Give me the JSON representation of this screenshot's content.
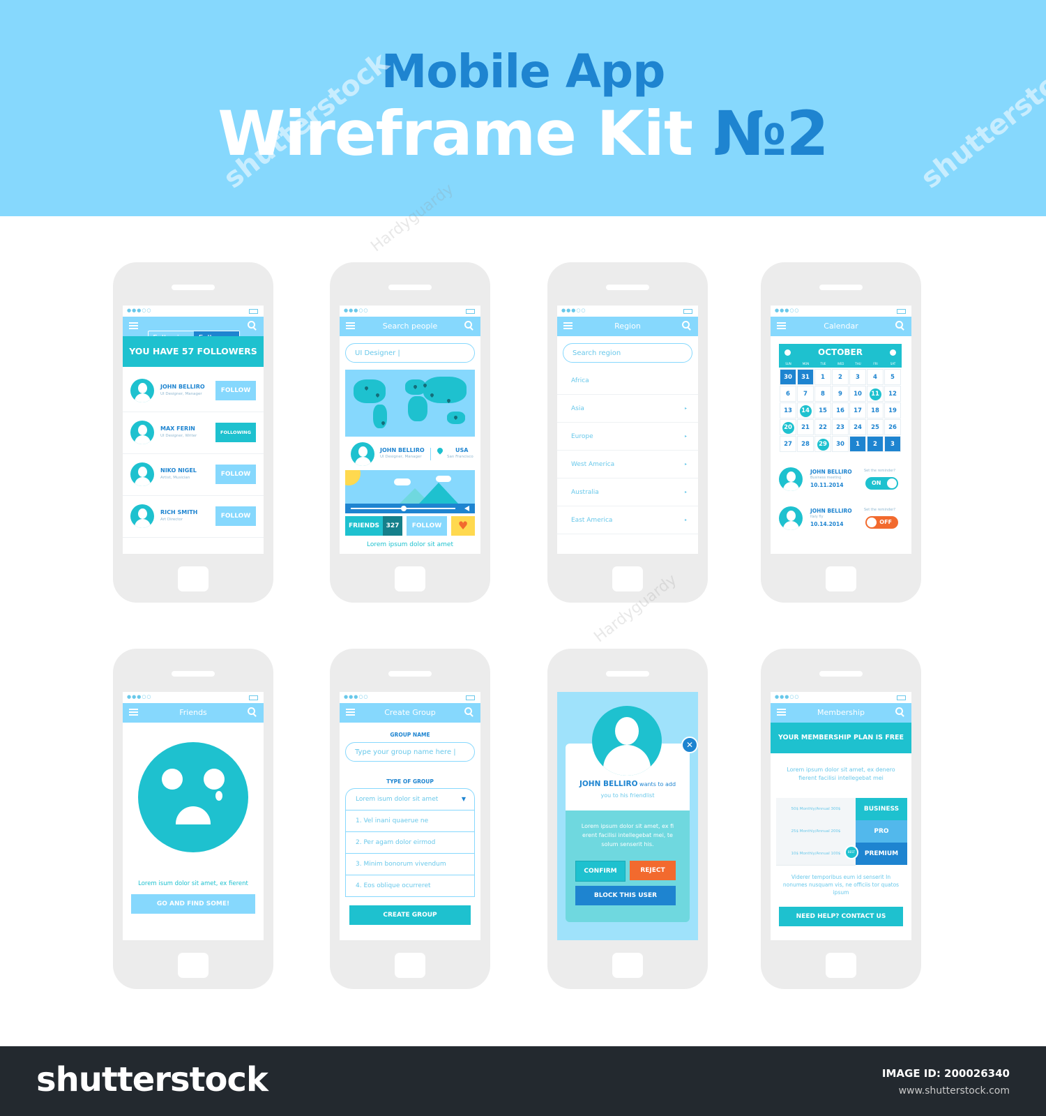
{
  "hero": {
    "line1": "Mobile App",
    "line2": "Wireframe Kit ",
    "line2_no": "№2"
  },
  "footer": {
    "logo": "shutterstock",
    "image_id": "IMAGE ID: 200026340",
    "site": "www.shutterstock.com"
  },
  "watermarks": {
    "brand": "shutterstock",
    "author": "Hardyguardy"
  },
  "colors": {
    "light_blue": "#86d8fd",
    "teal": "#1ec1cf",
    "blue": "#1e84d0",
    "orange": "#f26a2e",
    "yellow": "#ffd94f",
    "phone_body": "#ececec",
    "footer_bg": "#23292f"
  },
  "icons": {
    "menu": "hamburger-menu-icon",
    "search": "search-icon",
    "avatar": "user-avatar-icon",
    "pin": "location-pin-icon",
    "heart": "heart-icon",
    "close": "close-icon",
    "sad": "sad-face-icon"
  },
  "status_dots": "●●●○○",
  "followers": {
    "tab_following": "Following",
    "tab_followers": "Followers",
    "banner": "YOU HAVE 57 FOLLOWERS",
    "rows": [
      {
        "name": "JOHN BELLIRO",
        "role": "UI Designer, Manager",
        "action": "FOLLOW"
      },
      {
        "name": "MAX FERIN",
        "role": "UI Designer, Writer",
        "action": "FOLLOWING"
      },
      {
        "name": "NIKO NIGEL",
        "role": "Artist, Musician",
        "action": "FOLLOW"
      },
      {
        "name": "RICH SMITH",
        "role": "Art Director",
        "action": "FOLLOW"
      }
    ]
  },
  "search_people": {
    "title": "Search people",
    "query": "UI Designer |",
    "user_name": "JOHN BELLIRO",
    "user_role": "UI Designer, Manager",
    "country": "USA",
    "city": "San Francisco",
    "friends_label": "FRIENDS",
    "friends_count": "327",
    "follow_label": "FOLLOW",
    "caption": "Lorem ipsum dolor sit amet"
  },
  "region": {
    "title": "Region",
    "placeholder": "Search region",
    "items": [
      "Africa",
      "Asia",
      "Europe",
      "West America",
      "Australia",
      "East America"
    ],
    "arrow": "▸"
  },
  "calendar": {
    "title": "Calendar",
    "month": "OCTOBER",
    "dows": [
      "SUN",
      "MON",
      "TUE",
      "WED",
      "THU",
      "FRI",
      "SAT"
    ],
    "weeks": [
      [
        "30",
        "31",
        "1",
        "2",
        "3",
        "4",
        "5"
      ],
      [
        "6",
        "7",
        "8",
        "9",
        "10",
        "11",
        "12"
      ],
      [
        "13",
        "14",
        "15",
        "16",
        "17",
        "18",
        "19"
      ],
      [
        "20",
        "21",
        "22",
        "23",
        "24",
        "25",
        "26"
      ],
      [
        "27",
        "28",
        "29",
        "30",
        "1",
        "2",
        "3"
      ]
    ],
    "outside_days": [
      [
        0,
        0
      ],
      [
        0,
        1
      ],
      [
        4,
        4
      ],
      [
        4,
        5
      ],
      [
        4,
        6
      ]
    ],
    "marked_days": [
      [
        1,
        5
      ],
      [
        2,
        1
      ],
      [
        3,
        0
      ],
      [
        4,
        2
      ]
    ],
    "reminders": [
      {
        "name": "JOHN BELLIRO",
        "note": "Business meeting",
        "date": "10.11.2014",
        "question": "Set the reminder?",
        "state": "ON"
      },
      {
        "name": "JOHN BELLIRO",
        "note": "Italy fly",
        "date": "10.14.2014",
        "question": "Set the reminder?",
        "state": "OFF"
      }
    ]
  },
  "friends": {
    "title": "Friends",
    "message": "Lorem isum dolor sit amet, ex fierent",
    "button": "GO AND FIND SOME!"
  },
  "create_group": {
    "title": "Create Group",
    "name_label": "GROUP NAME",
    "name_placeholder": "Type your group name here |",
    "type_label": "TYPE OF GROUP",
    "selected": "Lorem isum dolor sit amet",
    "caret": "▼",
    "options": [
      "1. Vel inani quaerue ne",
      "2. Per agam dolor eirmod",
      "3. Minim bonorum vivendum",
      "4. Eos oblique ocurreret"
    ],
    "button": "CREATE GROUP"
  },
  "friend_request": {
    "name": "JOHN BELLIRO",
    "text1": " wants to add",
    "text2": "you to his friendlist",
    "body": "Lorem ipsum dolor sit amet, ex fi erent facilisi intellegebat mei, te solum senserit his.",
    "confirm": "CONFIRM",
    "reject": "REJECT",
    "block": "BLOCK THIS USER",
    "close": "✕"
  },
  "membership": {
    "title": "Membership",
    "banner": "YOUR MEMBERSHIP PLAN IS FREE",
    "intro": "Lorem ipsum dolor sit amet, ex denero fierent facilisi intellegebat mei",
    "plans": [
      {
        "price": "50$ Monthly/Annual 300$",
        "name": "BUSINESS"
      },
      {
        "price": "25$ Monthly/Annual 200$",
        "name": "PRO"
      },
      {
        "price": "10$ Monthly/Annual 100$",
        "name": "PREMIUM"
      }
    ],
    "badge": "BEST",
    "outro": "Viderer temporibus eum id senserit In nonumes nusquam vis, ne officiis tor quatos ipsum",
    "button": "NEED HELP? CONTACT US"
  }
}
